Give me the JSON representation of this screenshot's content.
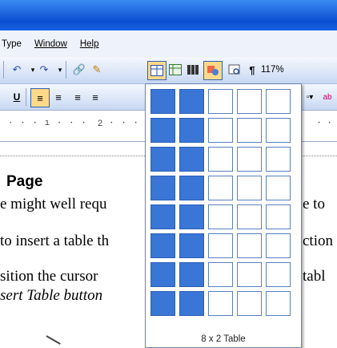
{
  "menu": {
    "items": [
      "Type",
      "Window",
      "Help"
    ]
  },
  "toolbar": {
    "zoom": "117%"
  },
  "ruler": {
    "marker": "2"
  },
  "document": {
    "heading": "Page",
    "lines": [
      "e might well requ",
      "to insert a table th",
      "sition the cursor",
      "sert Table button"
    ],
    "right_fragments": [
      "e to ",
      "ction",
      "tabl"
    ]
  },
  "table_picker": {
    "columns": 5,
    "rows": 8,
    "selected_cols": 2,
    "selected_rows": 8,
    "label": "8 x 2 Table",
    "selected_color": "#3a76d6"
  },
  "colors": {
    "title_bar": "#1d63dc",
    "menu_bg": "#eef2fb",
    "toolbar_bg": "#dde7f8"
  }
}
